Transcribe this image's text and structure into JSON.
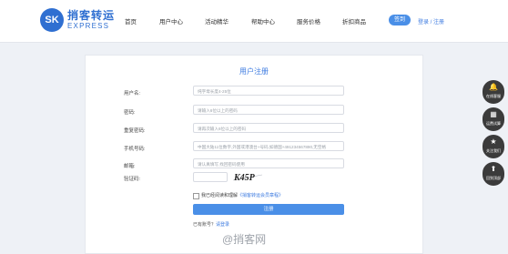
{
  "header": {
    "logo": {
      "mark": "SK",
      "cn": "捎客转运",
      "en": "EXPRESS"
    },
    "nav": [
      {
        "label": "首页"
      },
      {
        "label": "用户中心"
      },
      {
        "label": "活动精华"
      },
      {
        "label": "帮助中心"
      },
      {
        "label": "服务价格"
      },
      {
        "label": "折扣商品"
      }
    ],
    "highlight_button": "签到",
    "login": "登录",
    "separator": " / ",
    "register": "注册"
  },
  "form": {
    "title": "用户注册",
    "fields": [
      {
        "label": "用户名:",
        "placeholder": "纯字母长度4-25位"
      },
      {
        "label": "密码:",
        "placeholder": "请输入6位以上的密码"
      },
      {
        "label": "重复密码:",
        "placeholder": "请再次输入6位以上的密码"
      },
      {
        "label": "手机号码:",
        "placeholder": "中国大陆11位数字,外国或港澳台+号码,如德国+491234567890,无空格"
      },
      {
        "label": "邮箱:",
        "placeholder": "请认真填写,找回密码使用"
      }
    ],
    "captcha_label": "验证码:",
    "captcha_text": "K45P",
    "agree_text": "我已经阅读和理解",
    "agree_link": "《捎客转运会员章程》",
    "submit": "注册",
    "have_account": "已有账号？",
    "login_link": "请登录"
  },
  "sidebar": [
    {
      "icon": "bell-icon",
      "glyph": "🔔",
      "label": "在线客服"
    },
    {
      "icon": "calculator-icon",
      "glyph": "▦",
      "label": "运费试算"
    },
    {
      "icon": "star-icon",
      "glyph": "★",
      "label": "关注我们"
    },
    {
      "icon": "top-icon",
      "glyph": "⬆",
      "label": "回到顶部"
    }
  ],
  "watermark": "@捎客网"
}
